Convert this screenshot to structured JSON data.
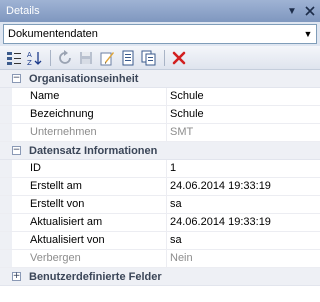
{
  "panel": {
    "title": "Details"
  },
  "dropdown": {
    "selected": "Dokumentendaten"
  },
  "toolbar": {
    "buttons": [
      {
        "icon": "categorized-icon"
      },
      {
        "icon": "sort-alphabetical-icon"
      },
      {
        "icon": "refresh-icon"
      },
      {
        "icon": "save-icon"
      },
      {
        "icon": "edit-icon"
      },
      {
        "icon": "document-icon"
      },
      {
        "icon": "copy-icon"
      },
      {
        "icon": "delete-icon"
      }
    ]
  },
  "categories": [
    {
      "label": "Organisationseinheit",
      "toggle": "−",
      "rows": [
        {
          "name": "Name",
          "value": "Schule"
        },
        {
          "name": "Bezeichnung",
          "value": "Schule"
        },
        {
          "name": "Unternehmen",
          "value": "SMT"
        }
      ]
    },
    {
      "label": "Datensatz Informationen",
      "toggle": "−",
      "rows": [
        {
          "name": "ID",
          "value": "1"
        },
        {
          "name": "Erstellt am",
          "value": "24.06.2014 19:33:19"
        },
        {
          "name": "Erstellt von",
          "value": "sa"
        },
        {
          "name": "Aktualisiert am",
          "value": "24.06.2014 19:33:19"
        },
        {
          "name": "Aktualisiert von",
          "value": "sa"
        },
        {
          "name": "Verbergen",
          "value": "Nein"
        }
      ]
    },
    {
      "label": "Benutzerdefinierte Felder",
      "toggle": "+",
      "rows": []
    }
  ]
}
